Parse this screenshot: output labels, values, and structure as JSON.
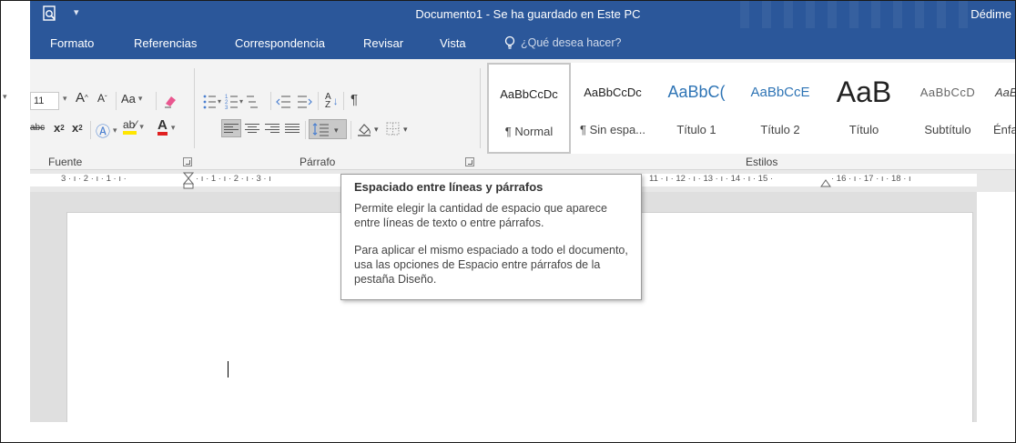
{
  "titlebar": {
    "doc_title": "Documento1  -  Se ha guardado en Este PC",
    "user": "Dédime",
    "qa_dropdown": "▾",
    "colors": {
      "brand": "#2b579a"
    }
  },
  "tabs": [
    {
      "label": "Formato"
    },
    {
      "label": "Referencias"
    },
    {
      "label": "Correspondencia"
    },
    {
      "label": "Revisar"
    },
    {
      "label": "Vista"
    }
  ],
  "tell_me": {
    "placeholder": "¿Qué desea hacer?"
  },
  "font_group": {
    "size_value": "11",
    "grow": "A",
    "shrink": "A",
    "case": "Aa",
    "strike": "abc",
    "subscript": "x",
    "superscript": "x",
    "label": "Fuente"
  },
  "paragraph_group": {
    "label": "Párrafo",
    "pilcrow": "¶"
  },
  "styles_group": {
    "label": "Estilos",
    "items": [
      {
        "preview": "AaBbCcDc",
        "name": "¶ Normal"
      },
      {
        "preview": "AaBbCcDc",
        "name": "¶ Sin espa..."
      },
      {
        "preview": "AaBbC(",
        "name": "Título 1"
      },
      {
        "preview": "AaBbCcE",
        "name": "Título 2"
      },
      {
        "preview": "AaB",
        "name": "Título"
      },
      {
        "preview": "AaBbCcD",
        "name": "Subtítulo"
      },
      {
        "preview": "AaBb",
        "name": "Énfasis"
      }
    ]
  },
  "ruler": {
    "left": "3 · ı · 2 · ı · 1 · ı · ",
    "right_of_marker": "· ı · 1 · ı · 2 · ı · 3 · ı",
    "right": "11 · ı · 12 · ı · 13 · ı · 14 · ı · 15 · ",
    "tail": "· 16 · ı · 17 · ı · 18 · ı"
  },
  "tooltip": {
    "title": "Espaciado entre líneas y párrafos",
    "p1": "Permite elegir la cantidad de espacio que aparece entre líneas de texto o entre párrafos.",
    "p2": "Para aplicar el mismo espaciado a todo el documento, usa las opciones de Espacio entre párrafos de la pestaña Diseño."
  }
}
